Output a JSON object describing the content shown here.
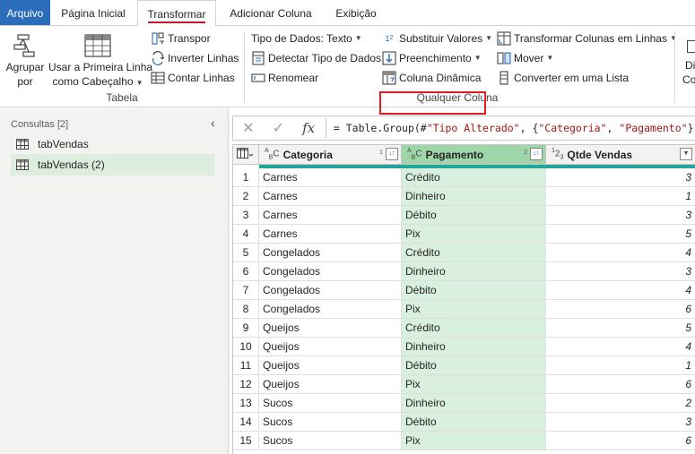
{
  "tabs": [
    "Arquivo",
    "Página Inicial",
    "Transformar",
    "Adicionar Coluna",
    "Exibição"
  ],
  "ribbon": {
    "tabela": {
      "agrupar_line1": "Agrupar",
      "agrupar_line2": "por",
      "primeira_linha_line1": "Usar a Primeira Linha",
      "primeira_linha_line2": "como Cabeçalho",
      "transpor": "Transpor",
      "inverter": "Inverter Linhas",
      "contar": "Contar Linhas",
      "group_label": "Tabela"
    },
    "qualquer": {
      "tipo_dados": "Tipo de Dados: Texto",
      "detectar": "Detectar Tipo de Dados",
      "renomear": "Renomear",
      "substituir": "Substituir Valores",
      "preenchimento": "Preenchimento",
      "coluna_dinamica": "Coluna Dinâmica",
      "transformar_colunas": "Transformar Colunas em Linhas",
      "mover": "Mover",
      "converter": "Converter em uma Lista",
      "group_label": "Qualquer Coluna"
    },
    "cut_line1": "Di",
    "cut_line2": "Col"
  },
  "queries": {
    "header": "Consultas [2]",
    "items": [
      "tabVendas",
      "tabVendas (2)"
    ]
  },
  "formula": "= Table.Group(#\"Tipo Alterado\", {\"Categoria\", \"Pagamento\"}, {{\"Q",
  "grid": {
    "columns": [
      {
        "type": "ABC",
        "name": "Categoria",
        "sort": "1"
      },
      {
        "type": "ABC",
        "name": "Pagamento",
        "sort": "2"
      },
      {
        "type": "123",
        "name": "Qtde Vendas",
        "sort": ""
      }
    ],
    "rows": [
      [
        "1",
        "Carnes",
        "Crédito",
        "3"
      ],
      [
        "2",
        "Carnes",
        "Dinheiro",
        "1"
      ],
      [
        "3",
        "Carnes",
        "Débito",
        "3"
      ],
      [
        "4",
        "Carnes",
        "Pix",
        "5"
      ],
      [
        "5",
        "Congelados",
        "Crédito",
        "4"
      ],
      [
        "6",
        "Congelados",
        "Dinheiro",
        "3"
      ],
      [
        "7",
        "Congelados",
        "Débito",
        "4"
      ],
      [
        "8",
        "Congelados",
        "Pix",
        "6"
      ],
      [
        "9",
        "Queijos",
        "Crédito",
        "5"
      ],
      [
        "10",
        "Queijos",
        "Dinheiro",
        "4"
      ],
      [
        "11",
        "Queijos",
        "Débito",
        "1"
      ],
      [
        "12",
        "Queijos",
        "Pix",
        "6"
      ],
      [
        "13",
        "Sucos",
        "Dinheiro",
        "2"
      ],
      [
        "14",
        "Sucos",
        "Débito",
        "3"
      ],
      [
        "15",
        "Sucos",
        "Pix",
        "6"
      ]
    ]
  },
  "colors": {
    "accent_blue": "#2b6cbb",
    "selected_header": "#9ed6aa",
    "selected_column": "#d9f0df",
    "quality_bar": "#1fa79b",
    "highlight_red": "#e11b22"
  }
}
